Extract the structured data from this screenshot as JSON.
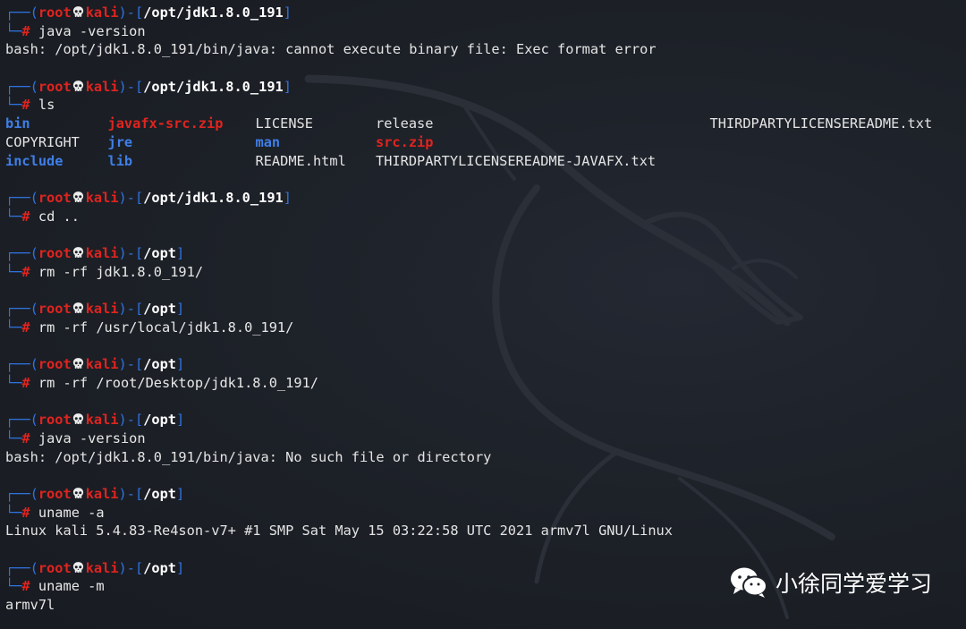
{
  "prompt": {
    "user": "root",
    "host": "kali",
    "corner_top": "┌──(",
    "corner_bottom": "└─",
    "hash": "#",
    "sep_open": ")-[",
    "sep_close": "]"
  },
  "blocks": [
    {
      "cwd": "/opt/jdk1.8.0_191",
      "command": "java -version",
      "output": [
        "bash: /opt/jdk1.8.0_191/bin/java: cannot execute binary file: Exec format error"
      ]
    },
    {
      "cwd": "/opt/jdk1.8.0_191",
      "command": "ls",
      "ls": true
    },
    {
      "cwd": "/opt/jdk1.8.0_191",
      "command": "cd .."
    },
    {
      "cwd": "/opt",
      "command": "rm -rf jdk1.8.0_191/"
    },
    {
      "cwd": "/opt",
      "command": "rm -rf /usr/local/jdk1.8.0_191/"
    },
    {
      "cwd": "/opt",
      "command": "rm -rf /root/Desktop/jdk1.8.0_191/"
    },
    {
      "cwd": "/opt",
      "command": "java -version",
      "output": [
        "bash: /opt/jdk1.8.0_191/bin/java: No such file or directory"
      ]
    },
    {
      "cwd": "/opt",
      "command": "uname -a",
      "output": [
        "Linux kali 5.4.83-Re4son-v7+ #1 SMP Sat May 15 03:22:58 UTC 2021 armv7l GNU/Linux"
      ]
    },
    {
      "cwd": "/opt",
      "command": "uname -m",
      "output": [
        "armv7l"
      ]
    }
  ],
  "ls_listing": [
    [
      {
        "name": "bin",
        "kind": "dir"
      },
      {
        "name": "javafx-src.zip",
        "kind": "zip"
      },
      {
        "name": "LICENSE",
        "kind": "file"
      },
      {
        "name": "release",
        "kind": "file"
      },
      {
        "name": "THIRDPARTYLICENSEREADME.txt",
        "kind": "file"
      }
    ],
    [
      {
        "name": "COPYRIGHT",
        "kind": "file"
      },
      {
        "name": "jre",
        "kind": "dir"
      },
      {
        "name": "man",
        "kind": "dir"
      },
      {
        "name": "src.zip",
        "kind": "zip"
      }
    ],
    [
      {
        "name": "include",
        "kind": "dir"
      },
      {
        "name": "lib",
        "kind": "dir"
      },
      {
        "name": "README.html",
        "kind": "file"
      },
      {
        "name": "THIRDPARTYLICENSEREADME-JAVAFX.txt",
        "kind": "file"
      }
    ]
  ],
  "watermark": {
    "text": "小徐同学爱学习",
    "icon": "wechat-icon"
  },
  "colors": {
    "background": "#1b1e24",
    "prompt_blue": "#2f73e0",
    "prompt_red": "#e0241f",
    "directory": "#3f7fe8",
    "archive": "#e0241f",
    "text": "#e4e4e4"
  }
}
